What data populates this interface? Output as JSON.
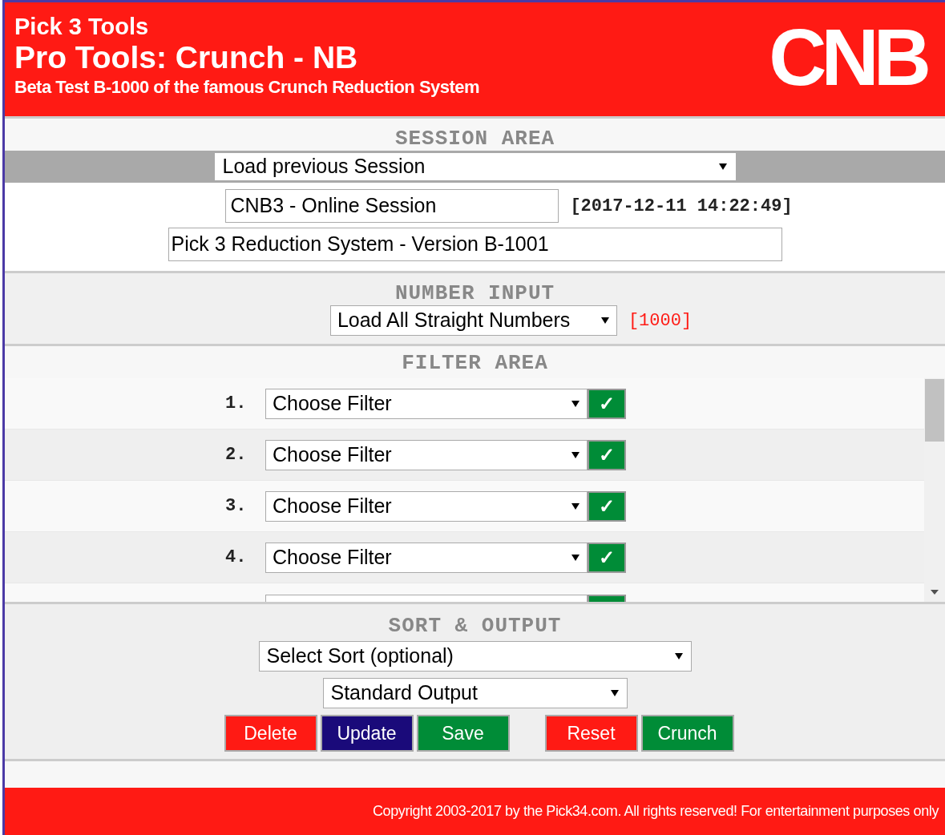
{
  "header": {
    "small_title": "Pick 3 Tools",
    "title": "Pro Tools: Crunch - NB",
    "subtitle": "Beta Test B-1000 of the famous Crunch Reduction System",
    "logo": "CNB"
  },
  "session_area": {
    "heading": "SESSION AREA",
    "session_select": "Load previous Session",
    "session_name": "CNB3 - Online Session",
    "timestamp": "[2017-12-11 14:22:49]",
    "description": "Pick 3 Reduction System - Version B-1001"
  },
  "number_input": {
    "heading": "NUMBER INPUT",
    "select": "Load All Straight Numbers",
    "count": "[1000]"
  },
  "filter_area": {
    "heading": "FILTER AREA",
    "filters": [
      {
        "number": "1.",
        "select": "Choose Filter",
        "button": "✓"
      },
      {
        "number": "2.",
        "select": "Choose Filter",
        "button": "✓"
      },
      {
        "number": "3.",
        "select": "Choose Filter",
        "button": "✓"
      },
      {
        "number": "4.",
        "select": "Choose Filter",
        "button": "✓"
      }
    ]
  },
  "sort_output": {
    "heading": "SORT & OUTPUT",
    "sort_select": "Select Sort (optional)",
    "output_select": "Standard Output",
    "buttons": [
      {
        "label": "Delete",
        "kind": "danger"
      },
      {
        "label": "Update",
        "kind": "primary"
      },
      {
        "label": "Save",
        "kind": "success"
      },
      {
        "label": "Reset",
        "kind": "danger"
      },
      {
        "label": "Crunch",
        "kind": "success"
      }
    ]
  },
  "footer": {
    "copyright": "Copyright 2003-2017 by the Pick34.com. All rights reserved! For entertainment purposes only"
  }
}
